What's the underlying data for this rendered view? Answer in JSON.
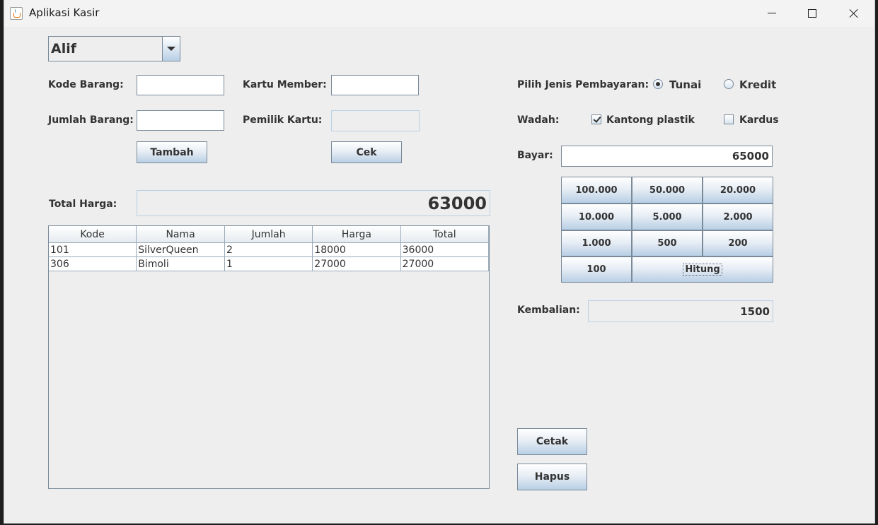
{
  "window": {
    "title": "Aplikasi Kasir"
  },
  "combo": {
    "value": "Alif"
  },
  "left": {
    "kode_barang_label": "Kode Barang:",
    "kode_barang_value": "",
    "jumlah_barang_label": "Jumlah Barang:",
    "jumlah_barang_value": "",
    "tambah_label": "Tambah",
    "kartu_member_label": "Kartu Member:",
    "kartu_member_value": "",
    "pemilik_kartu_label": "Pemilik Kartu:",
    "pemilik_kartu_value": "",
    "cek_label": "Cek",
    "total_harga_label": "Total Harga:",
    "total_harga_value": "63000"
  },
  "table": {
    "columns": [
      "Kode",
      "Nama",
      "Jumlah",
      "Harga",
      "Total"
    ],
    "rows": [
      [
        "101",
        "SilverQueen",
        "2",
        "18000",
        "36000"
      ],
      [
        "306",
        "Bimoli",
        "1",
        "27000",
        "27000"
      ]
    ]
  },
  "right": {
    "payment_label": "Pilih Jenis Pembayaran:",
    "payment_options": [
      "Tunai",
      "Kredit"
    ],
    "payment_selected": "Tunai",
    "wadah_label": "Wadah:",
    "wadah_options": [
      "Kantong plastik",
      "Kardus"
    ],
    "wadah_checked": [
      "Kantong plastik"
    ],
    "bayar_label": "Bayar:",
    "bayar_value": "65000",
    "denominations": [
      "100.000",
      "50.000",
      "20.000",
      "10.000",
      "5.000",
      "2.000",
      "1.000",
      "500",
      "200",
      "100"
    ],
    "hitung_label": "Hitung",
    "kembalian_label": "Kembalian:",
    "kembalian_value": "1500",
    "cetak_label": "Cetak",
    "hapus_label": "Hapus"
  },
  "colors": {
    "window_bg": "#eeeeee",
    "button_gradient_end": "#b8cfe5",
    "border": "#7a8a99"
  }
}
